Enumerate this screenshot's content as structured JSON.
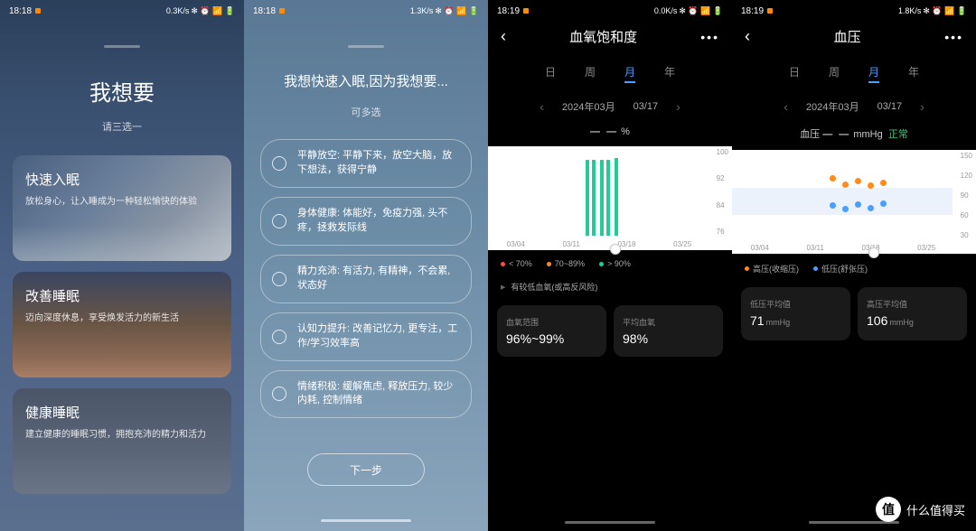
{
  "screens": [
    {
      "status": {
        "time": "18:18",
        "net": "0.3K/s"
      },
      "title": "我想要",
      "subtitle": "请三选一",
      "cards": [
        {
          "title": "快速入眠",
          "desc": "放松身心，让入睡成为一种轻松愉快的体验"
        },
        {
          "title": "改善睡眠",
          "desc": "迈向深度休息，享受焕发活力的新生活"
        },
        {
          "title": "健康睡眠",
          "desc": "建立健康的睡眠习惯，拥抱充沛的精力和活力"
        }
      ]
    },
    {
      "status": {
        "time": "18:18",
        "net": "1.3K/s"
      },
      "title": "我想快速入眠,因为我想要...",
      "subtitle": "可多选",
      "options": [
        "平静放空: 平静下来，放空大脑，放下想法，获得宁静",
        "身体健康: 体能好，免疫力强, 头不疼，拯救发际线",
        "精力充沛: 有活力, 有精神，不会累, 状态好",
        "认知力提升: 改善记忆力, 更专注，工作/学习效率高",
        "情绪积极: 缓解焦虑, 释放压力, 较少内耗, 控制情绪"
      ],
      "next": "下一步"
    },
    {
      "status": {
        "time": "18:19",
        "net": "0.0K/s"
      },
      "title": "血氧饱和度",
      "tabs": [
        "日",
        "周",
        "月",
        "年"
      ],
      "active_tab": "月",
      "date": "2024年03月",
      "day": "03/17",
      "value_suffix": "%",
      "legend": [
        {
          "label": "< 70%",
          "color": "#ff4d4d"
        },
        {
          "label": "70~89%",
          "color": "#ff8c1a"
        },
        {
          "label": "> 90%",
          "color": "#1FCC9A"
        }
      ],
      "risk": "有较低血氧(或高反风险)",
      "stats": [
        {
          "label": "血氧范围",
          "value": "96%~99%"
        },
        {
          "label": "平均血氧",
          "value": "98%"
        }
      ]
    },
    {
      "status": {
        "time": "18:19",
        "net": "1.8K/s"
      },
      "title": "血压",
      "tabs": [
        "日",
        "周",
        "月",
        "年"
      ],
      "active_tab": "月",
      "date": "2024年03月",
      "day": "03/17",
      "bp_prefix": "血压",
      "bp_unit": "mmHg",
      "bp_status": "正常",
      "legend": [
        {
          "label": "高压(收缩压)",
          "color": "#ff8c1a"
        },
        {
          "label": "低压(舒张压)",
          "color": "#4a9eff"
        }
      ],
      "stats": [
        {
          "label": "低压平均值",
          "value": "71",
          "unit": "mmHg"
        },
        {
          "label": "高压平均值",
          "value": "106",
          "unit": "mmHg"
        }
      ]
    }
  ],
  "chart_data": [
    {
      "type": "bar",
      "title": "血氧饱和度",
      "xlabel": "",
      "ylabel": "%",
      "ylim": [
        76,
        100
      ],
      "y_ticks": [
        100,
        92,
        84,
        76
      ],
      "x_ticks": [
        "03/04",
        "03/11",
        "03/18",
        "03/25"
      ],
      "categories": [
        "03/14a",
        "03/14b",
        "03/15a",
        "03/15b",
        "03/16"
      ],
      "values": [
        98,
        98,
        98,
        98,
        99
      ]
    },
    {
      "type": "scatter",
      "title": "血压",
      "xlabel": "",
      "ylabel": "mmHg",
      "ylim": [
        30,
        150
      ],
      "y_ticks": [
        150,
        120,
        90,
        60,
        30
      ],
      "x_ticks": [
        "03/04",
        "03/11",
        "03/18",
        "03/25"
      ],
      "series": [
        {
          "name": "高压(收缩压)",
          "x": [
            "03/13",
            "03/14",
            "03/15",
            "03/16",
            "03/17"
          ],
          "values": [
            113,
            103,
            108,
            101,
            106
          ]
        },
        {
          "name": "低压(舒张压)",
          "x": [
            "03/13",
            "03/14",
            "03/15",
            "03/16",
            "03/17"
          ],
          "values": [
            72,
            66,
            74,
            67,
            75
          ]
        }
      ]
    }
  ],
  "status_icons": "✻ ⏰ 📶 🔋",
  "watermark": {
    "icon": "值",
    "text": "什么值得买"
  }
}
